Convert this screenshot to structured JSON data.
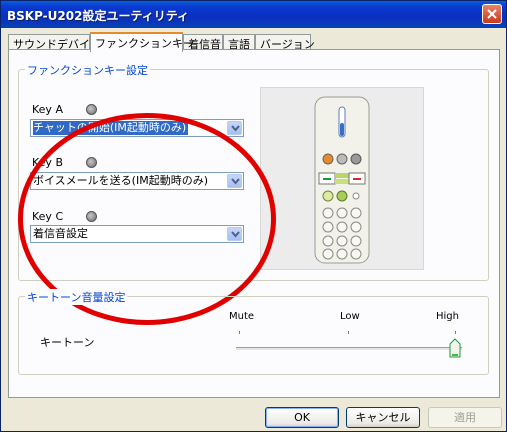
{
  "window": {
    "title": "BSKP-U202設定ユーティリティ"
  },
  "tabs": [
    {
      "label": "サウンドデバイス"
    },
    {
      "label": "ファンクションキー"
    },
    {
      "label": "着信音"
    },
    {
      "label": "言語"
    },
    {
      "label": "バージョン"
    }
  ],
  "function_keys": {
    "group_label": "ファンクションキー設定",
    "key_a": {
      "label": "Key A",
      "value": "チャットの開始(IM起動時のみ)"
    },
    "key_b": {
      "label": "Key B",
      "value": "ボイスメールを送る(IM起動時のみ)"
    },
    "key_c": {
      "label": "Key C",
      "value": "着信音設定"
    }
  },
  "keytone": {
    "group_label": "キートーン音量設定",
    "label": "キートーン",
    "level_mute": "Mute",
    "level_low": "Low",
    "level_high": "High",
    "selected": "High"
  },
  "buttons": {
    "ok": "OK",
    "cancel": "キャンセル",
    "apply": "適用"
  },
  "colors": {
    "annotation": "#e00000",
    "accent": "#0046d5",
    "title_bar": "#0a3bd0"
  }
}
